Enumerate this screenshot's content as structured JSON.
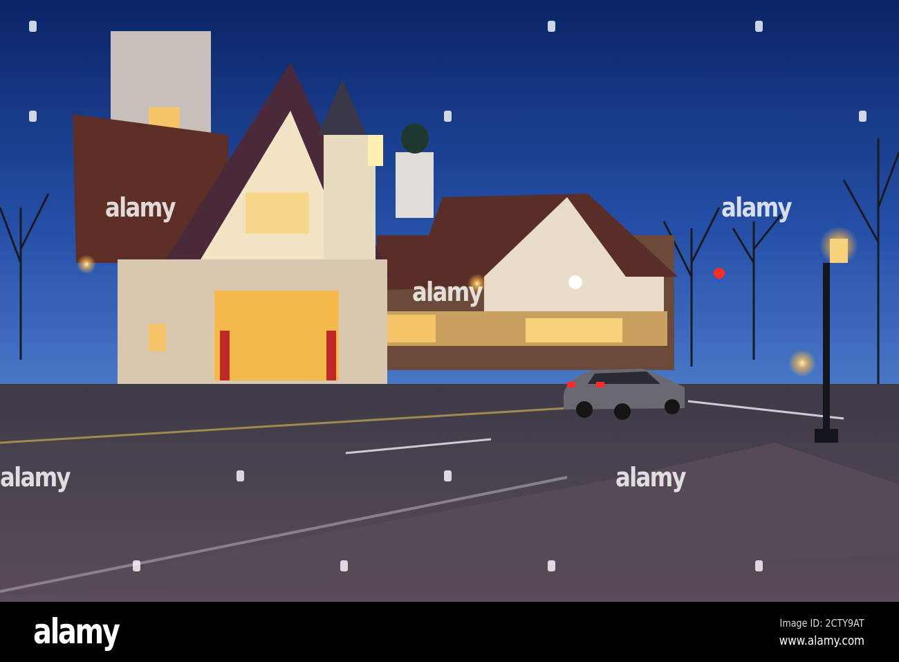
{
  "photo": {
    "subject": "Bavarian-style buildings at dusk with street and car",
    "colors": {
      "sky_top": "#0a2466",
      "sky_horizon": "#3a6bc4",
      "road": "#4a4452",
      "window_glow": "#f5c56a"
    }
  },
  "watermark": {
    "text": "alamy"
  },
  "footer": {
    "logo": "alamy",
    "image_id": "Image ID: 2CTY9AT",
    "url": "www.alamy.com"
  }
}
